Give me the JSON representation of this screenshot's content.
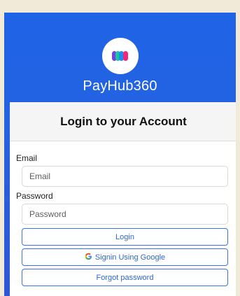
{
  "app": {
    "name": "PayHub360",
    "logo_icon": "payhub-logo-icon",
    "logo_colors": [
      "#7a3fe0",
      "#19c6a0",
      "#1d8cf0",
      "#f0277a"
    ]
  },
  "login": {
    "title": "Login to your Account",
    "email_label": "Email",
    "email_placeholder": "Email",
    "password_label": "Password",
    "password_placeholder": "Password",
    "login_button": "Login",
    "google_icon": "google-icon",
    "google_icon_glyph": "G",
    "google_button": "Signin Using Google",
    "forgot_button": "Forgot password"
  },
  "colors": {
    "header_blue": "#1f63e6",
    "button_border": "#3b73e4",
    "button_text": "#2f66d6"
  }
}
